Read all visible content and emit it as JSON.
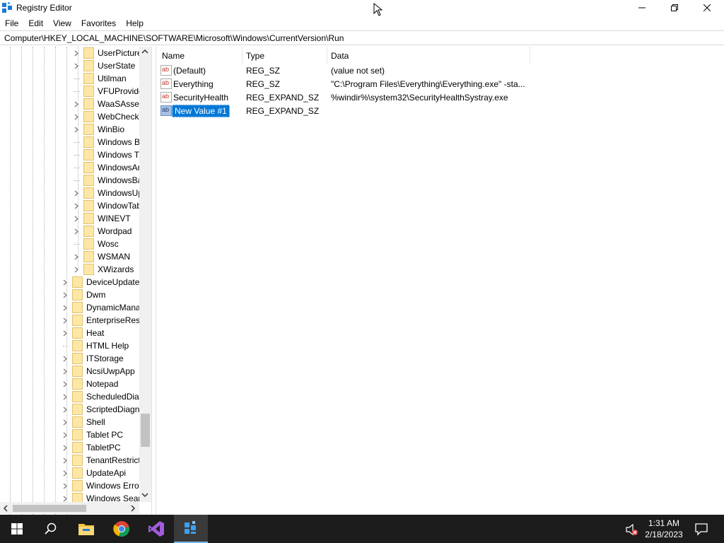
{
  "window": {
    "title": "Registry Editor",
    "minimize_icon": "minimize-icon",
    "restore_icon": "restore-icon",
    "close_icon": "close-icon"
  },
  "menu": [
    "File",
    "Edit",
    "View",
    "Favorites",
    "Help"
  ],
  "address": "Computer\\HKEY_LOCAL_MACHINE\\SOFTWARE\\Microsoft\\Windows\\CurrentVersion\\Run",
  "tree": {
    "level2": [
      "UserPicture",
      "UserState",
      "Utilman",
      "VFUProvide",
      "WaaSAsses",
      "WebCheck",
      "WinBio",
      "Windows B",
      "Windows T",
      "WindowsAr",
      "WindowsBa",
      "WindowsUp",
      "WindowTab",
      "WINEVT",
      "Wordpad",
      "Wosc",
      "WSMAN",
      "XWizards"
    ],
    "level2_expandable": [
      true,
      true,
      false,
      false,
      true,
      true,
      true,
      false,
      false,
      false,
      false,
      true,
      true,
      true,
      true,
      false,
      true,
      true
    ],
    "level1": [
      "DeviceUpdate",
      "Dwm",
      "DynamicMana",
      "EnterpriseRes",
      "Heat",
      "HTML Help",
      "ITStorage",
      "NcsiUwpApp",
      "Notepad",
      "ScheduledDiag",
      "ScriptedDiagn",
      "Shell",
      "Tablet PC",
      "TabletPC",
      "TenantRestrict",
      "UpdateApi",
      "Windows Erro",
      "Windows Sear"
    ],
    "level1_expandable": [
      true,
      true,
      true,
      true,
      true,
      false,
      true,
      true,
      true,
      true,
      true,
      true,
      true,
      true,
      true,
      true,
      true,
      true
    ]
  },
  "columns": {
    "name": "Name",
    "type": "Type",
    "data": "Data"
  },
  "values": [
    {
      "name": "(Default)",
      "type": "REG_SZ",
      "data": "(value not set)"
    },
    {
      "name": "Everything",
      "type": "REG_SZ",
      "data": "\"C:\\Program Files\\Everything\\Everything.exe\" -sta..."
    },
    {
      "name": "SecurityHealth",
      "type": "REG_EXPAND_SZ",
      "data": "%windir%\\system32\\SecurityHealthSystray.exe"
    },
    {
      "name": "New Value #1",
      "type": "REG_EXPAND_SZ",
      "data": ""
    }
  ],
  "taskbar": {
    "apps": [
      "windows-start-icon",
      "search-icon",
      "file-explorer-icon",
      "chrome-icon",
      "visual-studio-icon",
      "registry-editor-icon"
    ],
    "time": "1:31 AM",
    "date": "2/18/2023",
    "volume_icon": "volume-muted-icon",
    "notification_icon": "notification-icon"
  },
  "colors": {
    "selection": "#0078d7",
    "folder": "#fde7a6",
    "taskbar": "#1c1c1c"
  }
}
